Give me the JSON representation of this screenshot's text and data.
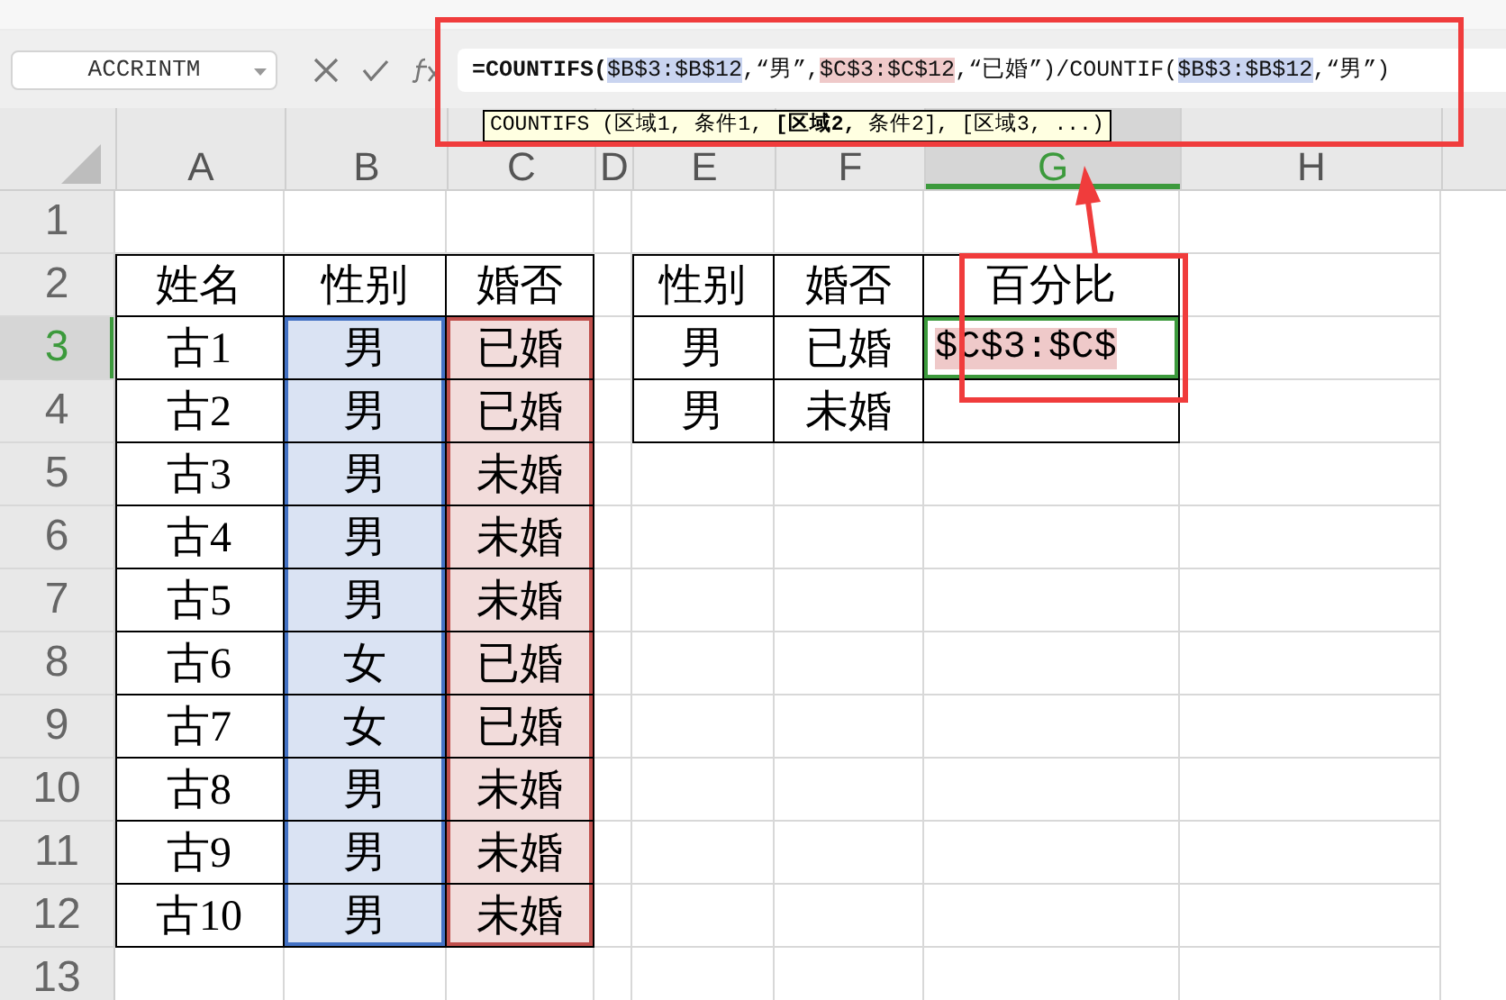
{
  "name_box": "ACCRINTM",
  "formula_bar": {
    "segments": [
      {
        "text": "=COUNTIFS(",
        "kind": "function"
      },
      {
        "text": "$B$3:$B$12",
        "kind": "ref",
        "color": "#c9d4f0"
      },
      {
        "text": ",“男”,",
        "kind": "plain"
      },
      {
        "text": "$C$3:$C$12",
        "kind": "ref",
        "color": "#efc9c9"
      },
      {
        "text": ",“已婚”)/COUNTIF(",
        "kind": "plain"
      },
      {
        "text": "$B$3:$B$12",
        "kind": "ref",
        "color": "#c9d4f0"
      },
      {
        "text": ",“男”)",
        "kind": "plain"
      }
    ]
  },
  "tooltip": "COUNTIFS (区域1, 条件1, **[区域2,** 条件2], [区域3, ...)",
  "columns": [
    {
      "label": "A",
      "selected": false
    },
    {
      "label": "B",
      "selected": false
    },
    {
      "label": "C",
      "selected": false
    },
    {
      "label": "D",
      "selected": false
    },
    {
      "label": "E",
      "selected": false
    },
    {
      "label": "F",
      "selected": false
    },
    {
      "label": "G",
      "selected": true
    },
    {
      "label": "H",
      "selected": false
    }
  ],
  "rows": [
    {
      "number": "1",
      "selected": false
    },
    {
      "number": "2",
      "selected": false,
      "cells": {
        "A": {
          "text": "姓名",
          "boxed": true
        },
        "B": {
          "text": "性别",
          "boxed": true
        },
        "C": {
          "text": "婚否",
          "boxed": true
        },
        "E": {
          "text": "性别",
          "boxed": true
        },
        "F": {
          "text": "婚否",
          "boxed": true
        },
        "G": {
          "text": "百分比",
          "boxed": true
        }
      }
    },
    {
      "number": "3",
      "selected": true,
      "cells": {
        "A": {
          "text": "古1",
          "boxed": true
        },
        "B": {
          "text": "男",
          "boxed": true,
          "color": "#4472c4"
        },
        "C": {
          "text": "已婚",
          "boxed": true,
          "color": "#c0504d"
        },
        "E": {
          "text": "男",
          "boxed": true
        },
        "F": {
          "text": "已婚",
          "boxed": true
        },
        "G": {
          "text": "$C$3:$C$",
          "boxed": true,
          "editing": true,
          "selected": true,
          "color": "#efc9c9"
        }
      }
    },
    {
      "number": "4",
      "selected": false,
      "cells": {
        "A": {
          "text": "古2",
          "boxed": true
        },
        "B": {
          "text": "男",
          "boxed": true,
          "color": "#4472c4"
        },
        "C": {
          "text": "已婚",
          "boxed": true,
          "color": "#c0504d"
        },
        "E": {
          "text": "男",
          "boxed": true
        },
        "F": {
          "text": "未婚",
          "boxed": true
        },
        "G": {
          "boxed": true
        }
      }
    },
    {
      "number": "5",
      "selected": false,
      "cells": {
        "A": {
          "text": "古3",
          "boxed": true
        },
        "B": {
          "text": "男",
          "boxed": true,
          "color": "#4472c4"
        },
        "C": {
          "text": "未婚",
          "boxed": true,
          "color": "#c0504d"
        }
      }
    },
    {
      "number": "6",
      "selected": false,
      "cells": {
        "A": {
          "text": "古4",
          "boxed": true
        },
        "B": {
          "text": "男",
          "boxed": true,
          "color": "#4472c4"
        },
        "C": {
          "text": "未婚",
          "boxed": true,
          "color": "#c0504d"
        }
      }
    },
    {
      "number": "7",
      "selected": false,
      "cells": {
        "A": {
          "text": "古5",
          "boxed": true
        },
        "B": {
          "text": "男",
          "boxed": true,
          "color": "#4472c4"
        },
        "C": {
          "text": "未婚",
          "boxed": true,
          "color": "#c0504d"
        }
      }
    },
    {
      "number": "8",
      "selected": false,
      "cells": {
        "A": {
          "text": "古6",
          "boxed": true
        },
        "B": {
          "text": "女",
          "boxed": true,
          "color": "#4472c4"
        },
        "C": {
          "text": "已婚",
          "boxed": true,
          "color": "#c0504d"
        }
      }
    },
    {
      "number": "9",
      "selected": false,
      "cells": {
        "A": {
          "text": "古7",
          "boxed": true
        },
        "B": {
          "text": "女",
          "boxed": true,
          "color": "#4472c4"
        },
        "C": {
          "text": "已婚",
          "boxed": true,
          "color": "#c0504d"
        }
      }
    },
    {
      "number": "10",
      "selected": false,
      "cells": {
        "A": {
          "text": "古8",
          "boxed": true
        },
        "B": {
          "text": "男",
          "boxed": true,
          "color": "#4472c4"
        },
        "C": {
          "text": "未婚",
          "boxed": true,
          "color": "#c0504d"
        }
      }
    },
    {
      "number": "11",
      "selected": false,
      "cells": {
        "A": {
          "text": "古9",
          "boxed": true
        },
        "B": {
          "text": "男",
          "boxed": true,
          "color": "#4472c4"
        },
        "C": {
          "text": "未婚",
          "boxed": true,
          "color": "#c0504d"
        }
      }
    },
    {
      "number": "12",
      "selected": false,
      "cells": {
        "A": {
          "text": "古10",
          "boxed": true
        },
        "B": {
          "text": "男",
          "boxed": true,
          "color": "#4472c4"
        },
        "C": {
          "text": "未婚",
          "boxed": true,
          "color": "#c0504d"
        }
      }
    },
    {
      "number": "13",
      "selected": false
    }
  ]
}
